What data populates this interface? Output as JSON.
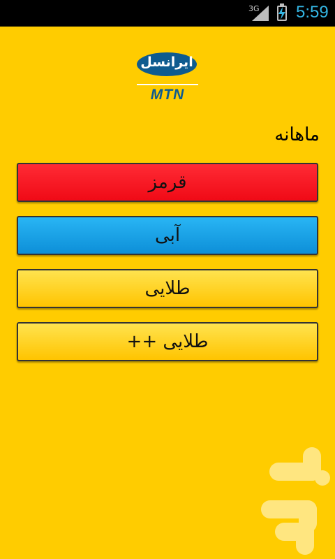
{
  "status_bar": {
    "network": "3G",
    "time": "5:59",
    "clock_color": "#34b6e4"
  },
  "brand": {
    "name": "ایرانسل",
    "sub": "MTN",
    "color": "#0e5b8f"
  },
  "section": {
    "title": "ماهانه"
  },
  "plans": [
    {
      "label": "قرمز",
      "color": "#ff1a25"
    },
    {
      "label": "آبی",
      "color": "#1ea5ea"
    },
    {
      "label": "طلایی",
      "color": "#ffd21f"
    },
    {
      "label": "طلایی ++",
      "color": "#ffd21f"
    }
  ],
  "theme": {
    "background": "#ffcc00"
  }
}
